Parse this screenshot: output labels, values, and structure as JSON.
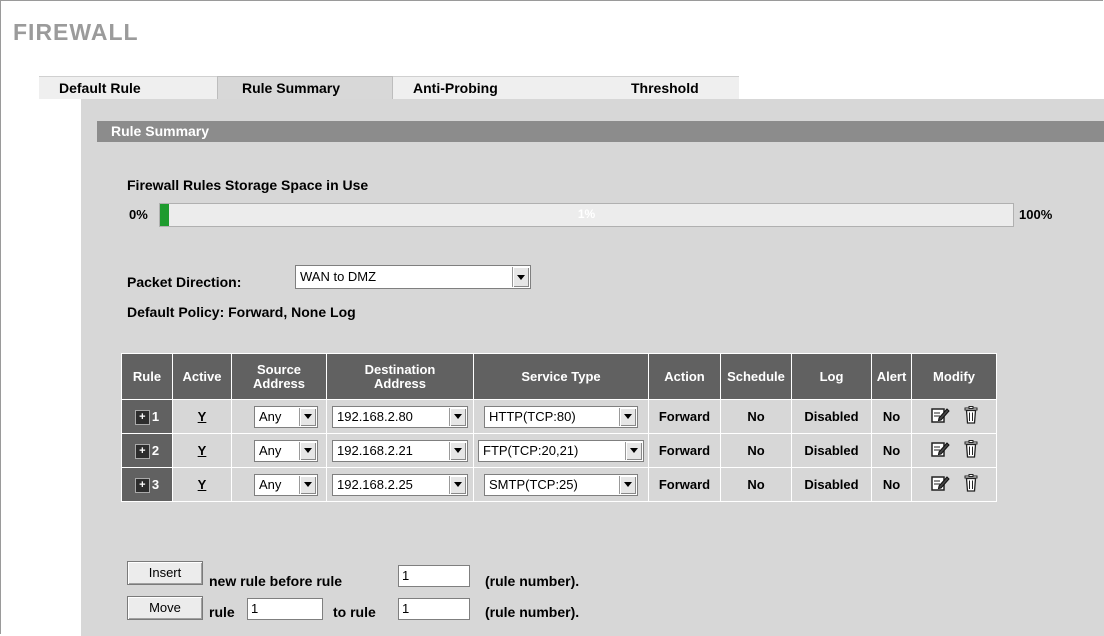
{
  "page": {
    "title": "FIREWALL"
  },
  "tabs": [
    "Default Rule",
    "Rule Summary",
    "Anti-Probing",
    "Threshold"
  ],
  "section": {
    "title": "Rule Summary"
  },
  "storage": {
    "label": "Firewall Rules Storage Space in Use",
    "min_label": "0%",
    "max_label": "100%",
    "usage_text": "1%",
    "usage_fraction": 0.01,
    "fill_color": "#1e9b2e"
  },
  "direction": {
    "label": "Packet Direction:",
    "value": "WAN to DMZ"
  },
  "policy": {
    "text": "Default Policy: Forward, None Log"
  },
  "table": {
    "headers": {
      "rule": "Rule",
      "active": "Active",
      "source_1": "Source",
      "source_2": "Address",
      "dest_1": "Destination",
      "dest_2": "Address",
      "service": "Service Type",
      "action": "Action",
      "schedule": "Schedule",
      "log": "Log",
      "alert": "Alert",
      "modify": "Modify"
    },
    "rows": [
      {
        "num": "1",
        "active": "Y",
        "source": "Any",
        "dest": "192.168.2.80",
        "service": "HTTP(TCP:80)",
        "action": "Forward",
        "schedule": "No",
        "log": "Disabled",
        "alert": "No"
      },
      {
        "num": "2",
        "active": "Y",
        "source": "Any",
        "dest": "192.168.2.21",
        "service": "FTP(TCP:20,21)",
        "action": "Forward",
        "schedule": "No",
        "log": "Disabled",
        "alert": "No"
      },
      {
        "num": "3",
        "active": "Y",
        "source": "Any",
        "dest": "192.168.2.25",
        "service": "SMTP(TCP:25)",
        "action": "Forward",
        "schedule": "No",
        "log": "Disabled",
        "alert": "No"
      }
    ]
  },
  "controls": {
    "insert_button": "Insert",
    "insert_text": "new rule before rule",
    "insert_value": "1",
    "rule_number_note": "(rule number).",
    "move_button": "Move",
    "move_rule_label": "rule",
    "move_from_value": "1",
    "move_to_label": "to rule",
    "move_to_value": "1"
  },
  "icons": {
    "expand": "plus-box-icon",
    "edit": "edit-icon",
    "delete": "trash-icon",
    "dropdown": "chevron-down-icon"
  }
}
